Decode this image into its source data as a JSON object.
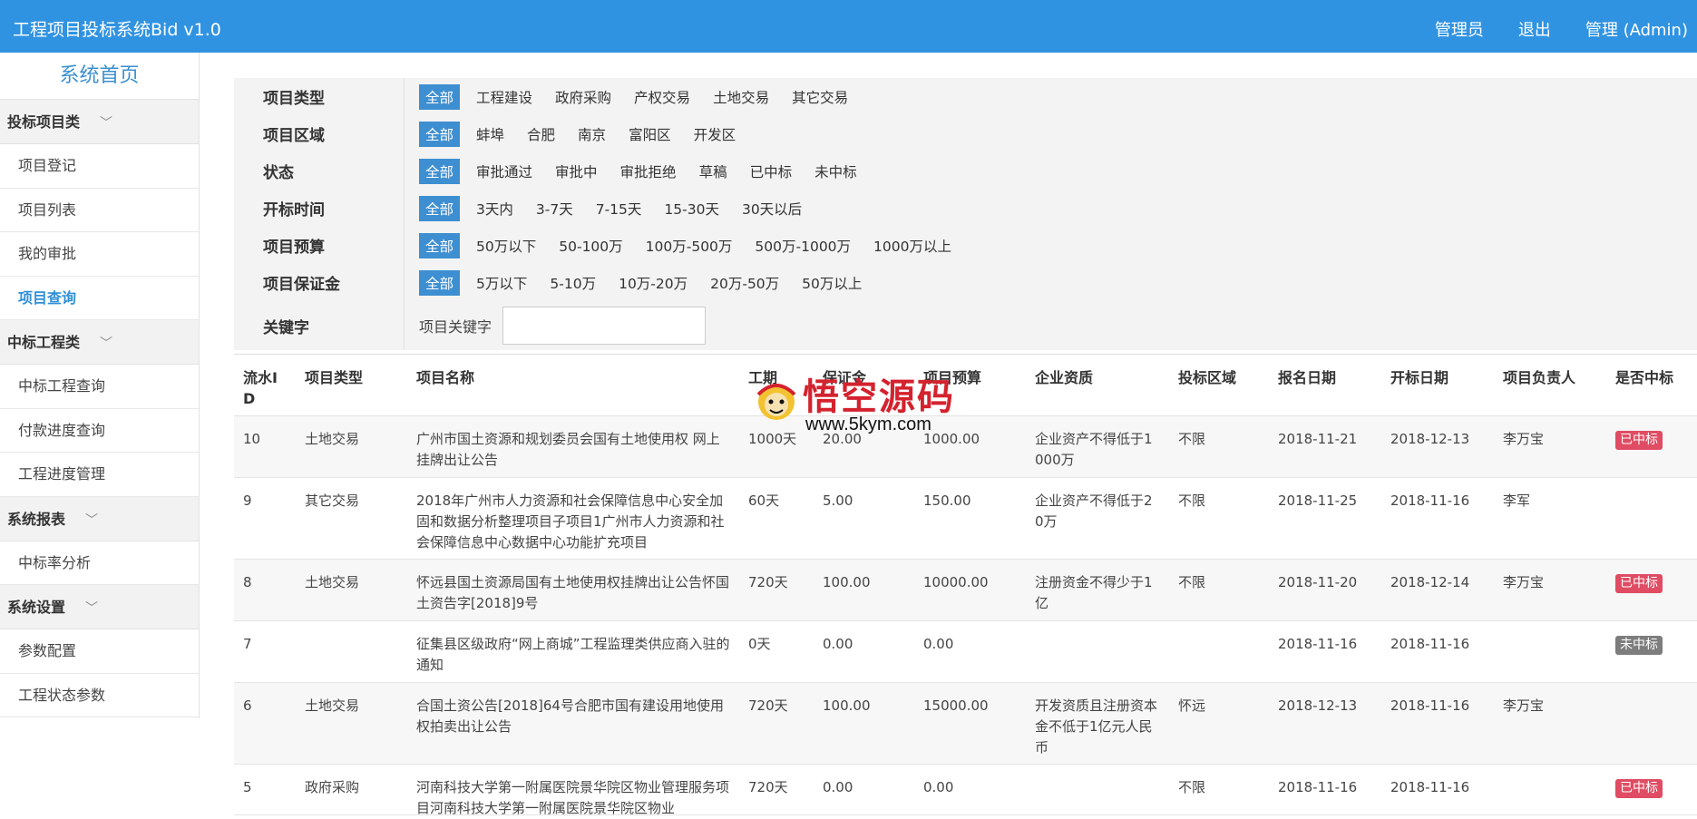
{
  "header": {
    "title": "工程项目投标系统Bid v1.0",
    "nav": [
      "管理员",
      "退出",
      "管理 (Admin)"
    ]
  },
  "sidebar": {
    "home": "系统首页",
    "groups": [
      {
        "label": "投标项目类",
        "items": [
          "项目登记",
          "项目列表",
          "我的审批",
          "项目查询"
        ]
      },
      {
        "label": "中标工程类",
        "items": [
          "中标工程查询",
          "付款进度查询",
          "工程进度管理"
        ]
      },
      {
        "label": "系统报表",
        "items": [
          "中标率分析"
        ]
      },
      {
        "label": "系统设置",
        "items": [
          "参数配置",
          "工程状态参数"
        ]
      }
    ],
    "active_item": "项目查询"
  },
  "filters": {
    "rows": [
      {
        "label": "项目类型",
        "options": [
          "全部",
          "工程建设",
          "政府采购",
          "产权交易",
          "土地交易",
          "其它交易"
        ]
      },
      {
        "label": "项目区域",
        "options": [
          "全部",
          "蚌埠",
          "合肥",
          "南京",
          "富阳区",
          "开发区"
        ]
      },
      {
        "label": "状态",
        "options": [
          "全部",
          "审批通过",
          "审批中",
          "审批拒绝",
          "草稿",
          "已中标",
          "未中标"
        ]
      },
      {
        "label": "开标时间",
        "options": [
          "全部",
          "3天内",
          "3-7天",
          "7-15天",
          "15-30天",
          "30天以后"
        ]
      },
      {
        "label": "项目预算",
        "options": [
          "全部",
          "50万以下",
          "50-100万",
          "100万-500万",
          "500万-1000万",
          "1000万以上"
        ]
      },
      {
        "label": "项目保证金",
        "options": [
          "全部",
          "5万以下",
          "5-10万",
          "10万-20万",
          "20万-50万",
          "50万以上"
        ]
      }
    ],
    "keyword": {
      "label": "关键字",
      "field_label": "项目关键字",
      "value": ""
    }
  },
  "table": {
    "headers": [
      "流水ID",
      "项目类型",
      "项目名称",
      "工期",
      "保证金",
      "项目预算",
      "企业资质",
      "投标区域",
      "报名日期",
      "开标日期",
      "项目负责人",
      "是否中标"
    ],
    "rows": [
      [
        "10",
        "土地交易",
        "广州市国土资源和规划委员会国有土地使用权 网上挂牌出让公告",
        "1000天",
        "20.00",
        "1000.00",
        "企业资产不得低于1000万",
        "不限",
        "2018-11-21",
        "2018-12-13",
        "李万宝",
        "已中标"
      ],
      [
        "9",
        "其它交易",
        "2018年广州市人力资源和社会保障信息中心安全加固和数据分析整理项目子项目1广州市人力资源和社会保障信息中心数据中心功能扩充项目",
        "60天",
        "5.00",
        "150.00",
        "企业资产不得低于20万",
        "不限",
        "2018-11-25",
        "2018-11-16",
        "李军",
        ""
      ],
      [
        "8",
        "土地交易",
        "怀远县国土资源局国有土地使用权挂牌出让公告怀国土资告字[2018]9号",
        "720天",
        "100.00",
        "10000.00",
        "注册资金不得少于1亿",
        "不限",
        "2018-11-20",
        "2018-12-14",
        "李万宝",
        "已中标"
      ],
      [
        "7",
        "",
        "征集县区级政府“网上商城”工程监理类供应商入驻的通知",
        "0天",
        "0.00",
        "0.00",
        "",
        "",
        "2018-11-16",
        "2018-11-16",
        "",
        "未中标"
      ],
      [
        "6",
        "土地交易",
        "合国土资公告[2018]64号合肥市国有建设用地使用权拍卖出让公告",
        "720天",
        "100.00",
        "15000.00",
        "开发资质且注册资本金不低于1亿元人民币",
        "怀远",
        "2018-12-13",
        "2018-11-16",
        "李万宝",
        ""
      ],
      [
        "5",
        "政府采购",
        "河南科技大学第一附属医院景华院区物业管理服务项目河南科技大学第一附属医院景华院区物业",
        "720天",
        "0.00",
        "0.00",
        "",
        "不限",
        "2018-11-16",
        "2018-11-16",
        "",
        "已中标"
      ]
    ]
  },
  "watermark": {
    "text": "悟空源码",
    "url": "www.5kym.com"
  },
  "colors": {
    "header": "#3093e2",
    "selected": "#3e8fd1",
    "win_badge": "#df4c63",
    "lose_badge": "#7d7d7d"
  }
}
